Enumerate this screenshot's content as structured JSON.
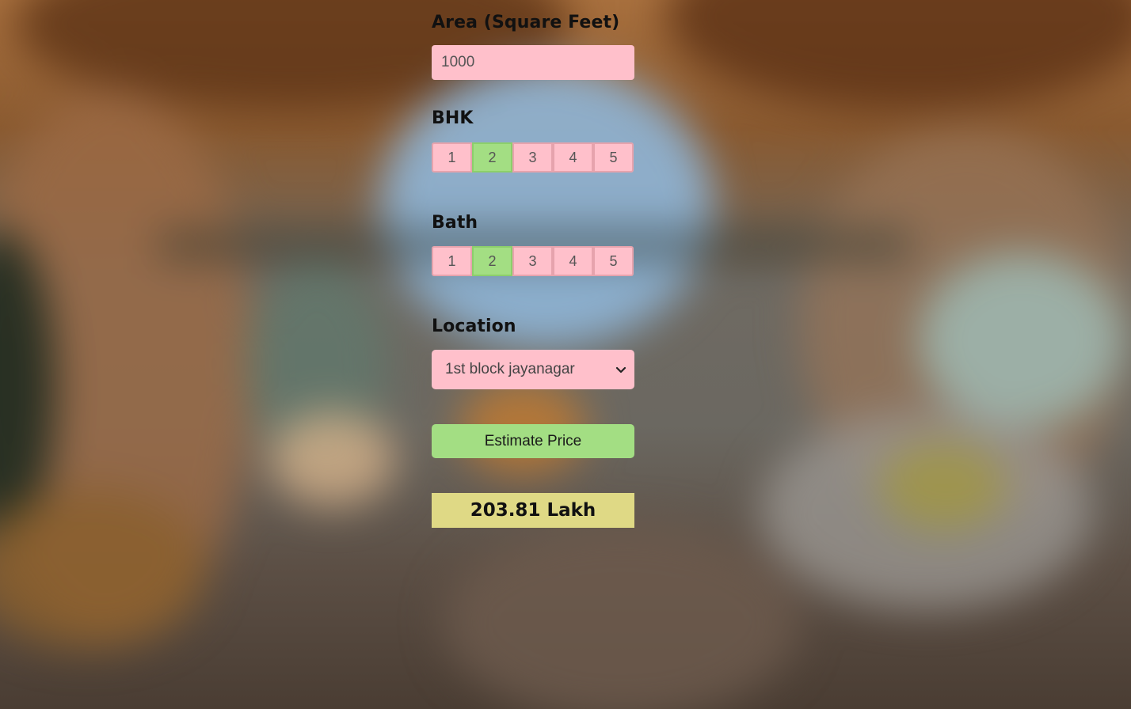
{
  "area": {
    "label": "Area (Square Feet)",
    "value": "1000"
  },
  "bhk": {
    "label": "BHK",
    "options": [
      "1",
      "2",
      "3",
      "4",
      "5"
    ],
    "selected": "2"
  },
  "bath": {
    "label": "Bath",
    "options": [
      "1",
      "2",
      "3",
      "4",
      "5"
    ],
    "selected": "2"
  },
  "location": {
    "label": "Location",
    "selected": "1st block jayanagar",
    "icon": "chevron-down-icon"
  },
  "estimate_button": {
    "label": "Estimate Price"
  },
  "result": {
    "text": "203.81 Lakh"
  },
  "colors": {
    "input_bg": "#ffc0cb",
    "selected_bg": "#a3de83",
    "result_bg": "#dfd985"
  }
}
